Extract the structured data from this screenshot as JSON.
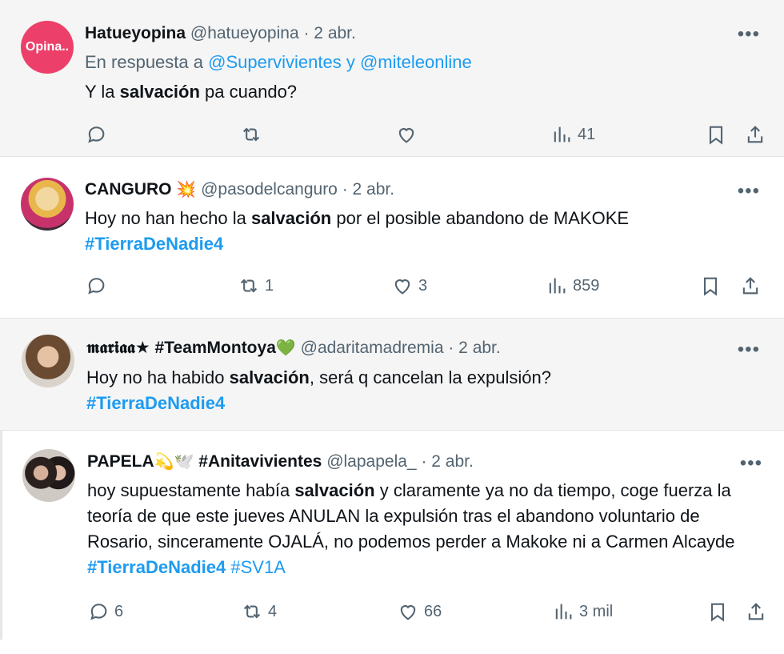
{
  "tweets": [
    {
      "avatar_text": "Opina..",
      "avatar_color": "#ec3f6a",
      "name": "Hatueyopina",
      "handle": "@hatueyopina",
      "date": "· 2 abr.",
      "reply_prefix": "En respuesta a",
      "reply_to": "@Supervivientes y @miteleonline",
      "text_before": "Y la",
      "highlight": "salvación",
      "text_after": "pa cuando?",
      "replies": "",
      "retweets": "",
      "likes": "",
      "views": "41"
    },
    {
      "name": "CANGURO",
      "name_emoji": "💥",
      "handle": "@pasodelcanguro",
      "date": "· 2 abr.",
      "text_before": "Hoy no han hecho la",
      "highlight": "salvación",
      "text_after": "por el posible abandono de MAKOKE",
      "hashtag": "#TierraDeNadie4",
      "replies": "",
      "retweets": "1",
      "likes": "3",
      "views": "859"
    },
    {
      "name": "𝖒𝖆𝖗𝖎𝖆𝖆★ #TeamMontoya",
      "name_emoji": "💚",
      "handle": "@adaritamadremia",
      "date": "· 2 abr.",
      "text_before": "Hoy no ha habido",
      "highlight": "salvación",
      "text_after": ", será q cancelan la expulsión?",
      "hashtag": "#TierraDeNadie4"
    },
    {
      "name": "PAPELA",
      "name_emoji": "💫🕊️",
      "name_suffix": "#Anitavivientes",
      "handle": "@lapapela_",
      "date": "· 2 abr.",
      "text_before": "hoy supuestamente había",
      "highlight": "salvación",
      "text_after": "y claramente ya no da tiempo, coge fuerza la teoría de que este jueves ANULAN la expulsión tras el abandono voluntario de Rosario, sinceramente OJALÁ, no podemos perder a Makoke ni a Carmen Alcayde",
      "hashtag": "#TierraDeNadie4",
      "hashtag2": "#SV1A",
      "replies": "6",
      "retweets": "4",
      "likes": "66",
      "views": "3 mil"
    }
  ],
  "icons": {
    "more": "more-icon",
    "reply": "reply-icon",
    "retweet": "retweet-icon",
    "like": "like-icon",
    "views": "views-icon",
    "bookmark": "bookmark-icon",
    "share": "share-icon"
  },
  "more_glyph": "•••",
  "colors": {
    "link": "#1d9bf0",
    "muted": "#536471",
    "text": "#0f1419"
  }
}
